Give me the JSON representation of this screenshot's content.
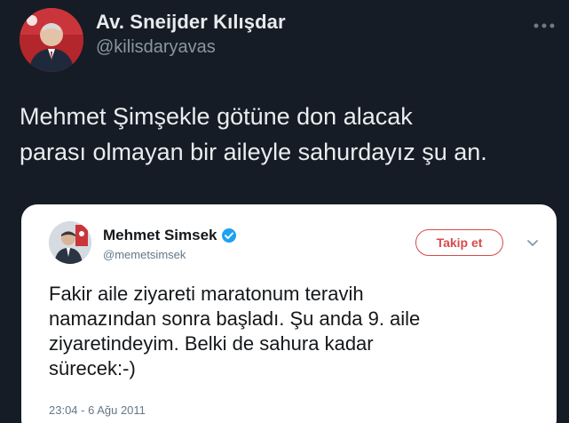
{
  "tweet": {
    "author_name": "Av. Sneijder Kılışdar",
    "author_handle": "@kilisdaryavas",
    "more_icon": "more-horizontal-icon",
    "text_lines": [
      "Mehmet Şimşekle götüne don alacak",
      "parası olmayan bir aileyle sahurdayız şu an."
    ]
  },
  "embedded": {
    "author_name": "Mehmet Simsek",
    "verified_icon": "verified-badge-icon",
    "author_handle": "@memetsimsek",
    "follow_label": "Takip et",
    "menu_icon": "chevron-down-icon",
    "text_lines": [
      "Fakir aile ziyareti maratonum teravih",
      "namazından sonra başladı. Şu anda 9. aile",
      "ziyaretindeyim. Belki de sahura kadar",
      "sürecek:-)"
    ],
    "timestamp": "23:04 - 6 Ağu 2011"
  },
  "colors": {
    "background": "#151c25",
    "follow_accent": "#d84a4a",
    "verified_blue": "#1da1f2"
  }
}
